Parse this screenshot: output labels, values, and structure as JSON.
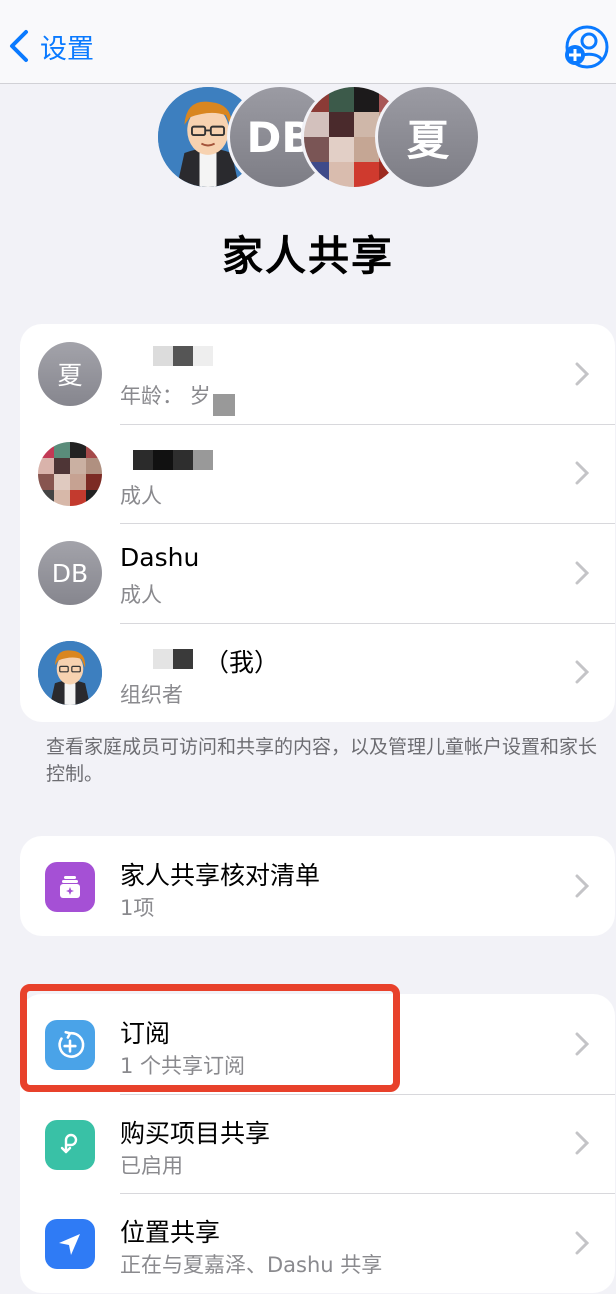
{
  "nav": {
    "back_label": "设置",
    "back_icon": "chevron-left-icon",
    "add_icon": "person-add-icon",
    "accent": "#0a7aff"
  },
  "header": {
    "title": "家人共享",
    "avatars": [
      {
        "type": "photo"
      },
      {
        "type": "initials",
        "text": "DB"
      },
      {
        "type": "photo-pixelated"
      },
      {
        "type": "initials",
        "text": "夏"
      }
    ]
  },
  "members": [
    {
      "avatar_text": "夏",
      "title": "",
      "subtitle": "年龄： 岁"
    },
    {
      "avatar_text": "",
      "title": "",
      "subtitle": "成人"
    },
    {
      "avatar_text": "DB",
      "title": "Dashu",
      "subtitle": "成人"
    },
    {
      "avatar_text": "",
      "title": "（我）",
      "subtitle": "组织者"
    }
  ],
  "members_footnote": "查看家庭成员可访问和共享的内容，以及管理儿童帐户设置和家长控制。",
  "checklist": {
    "title": "家人共享核对清单",
    "subtitle": "1项",
    "icon": "checklist-icon",
    "icon_color": "#a550d5"
  },
  "features": [
    {
      "title": "订阅",
      "subtitle": "1 个共享订阅",
      "icon": "subscription-icon",
      "icon_color": "#4aa3e8"
    },
    {
      "title": "购买项目共享",
      "subtitle": "已启用",
      "icon": "purchase-sharing-icon",
      "icon_color": "#39c1a6"
    },
    {
      "title": "位置共享",
      "subtitle": "正在与夏嘉泽、Dashu 共享",
      "icon": "location-icon",
      "icon_color": "#2f7bf5"
    }
  ],
  "highlight_color": "#e8412b"
}
